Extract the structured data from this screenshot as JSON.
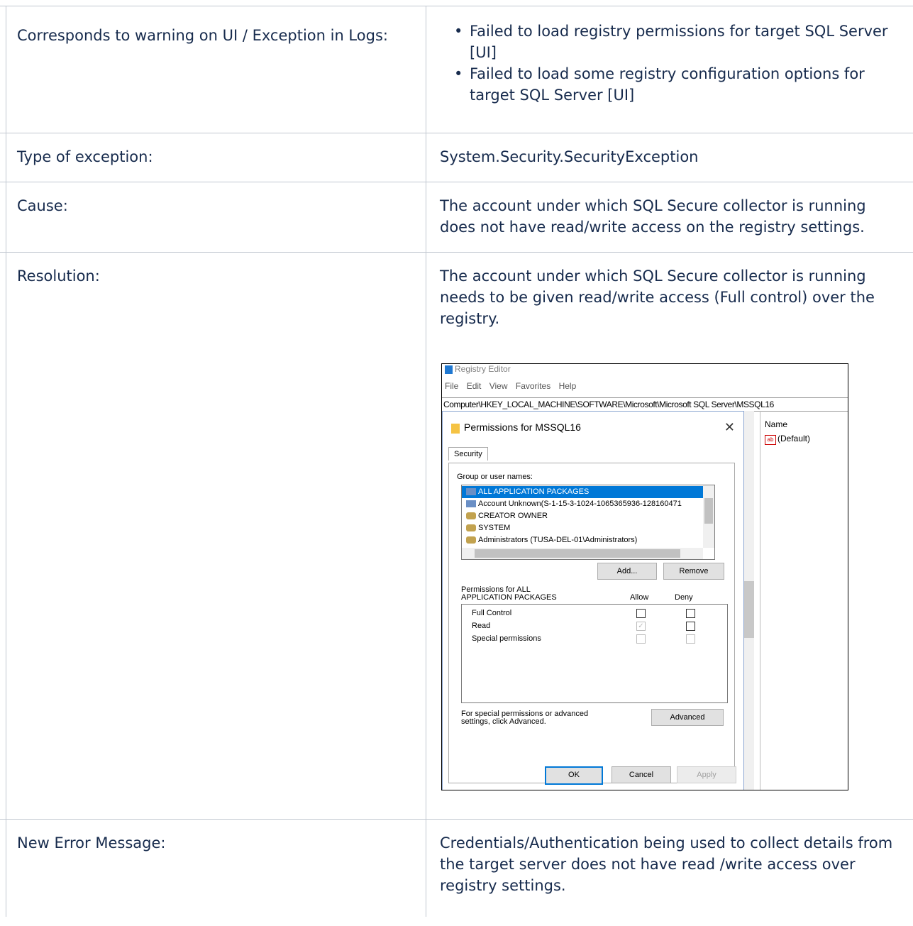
{
  "rows": {
    "warning": {
      "label": "Corresponds to warning on UI / Exception in Logs:",
      "items": [
        "Failed to load registry permissions for target SQL Server [UI]",
        "Failed to load some registry configuration options for target SQL Server [UI]"
      ]
    },
    "type": {
      "label": "Type of exception:",
      "value": "System.Security.SecurityException"
    },
    "cause": {
      "label": "Cause:",
      "value": "The account under which SQL Secure collector is running does not have read/write access on the registry settings."
    },
    "resolution": {
      "label": "Resolution:",
      "value": "The account under which SQL Secure collector is running needs to be given  read/write access (Full control) over the registry."
    },
    "new_error": {
      "label": "New Error Message:",
      "value": "Credentials/Authentication being used to collect details from the target server does not have read /write access over registry settings."
    }
  },
  "screenshot": {
    "window_title": "Registry Editor",
    "menu": [
      "File",
      "Edit",
      "View",
      "Favorites",
      "Help"
    ],
    "address": "Computer\\HKEY_LOCAL_MACHINE\\SOFTWARE\\Microsoft\\Microsoft SQL Server\\MSSQL16",
    "right_header": "Name",
    "right_value": "(Default)",
    "dialog": {
      "title": "Permissions for MSSQL16",
      "close": "✕",
      "tab": "Security",
      "group_label": "Group or user names:",
      "users": [
        "ALL APPLICATION PACKAGES",
        "Account Unknown(S-1-15-3-1024-1065365936-128160471",
        "CREATOR OWNER",
        "SYSTEM",
        "Administrators (TUSA-DEL-01\\Administrators)"
      ],
      "add": "Add...",
      "remove": "Remove",
      "perm_header": "Permissions for ALL APPLICATION PACKAGES",
      "allow": "Allow",
      "deny": "Deny",
      "perms": [
        "Full Control",
        "Read",
        "Special permissions"
      ],
      "adv_text": "For special permissions or advanced settings, click Advanced.",
      "advanced": "Advanced",
      "ok": "OK",
      "cancel": "Cancel",
      "apply": "Apply"
    }
  }
}
